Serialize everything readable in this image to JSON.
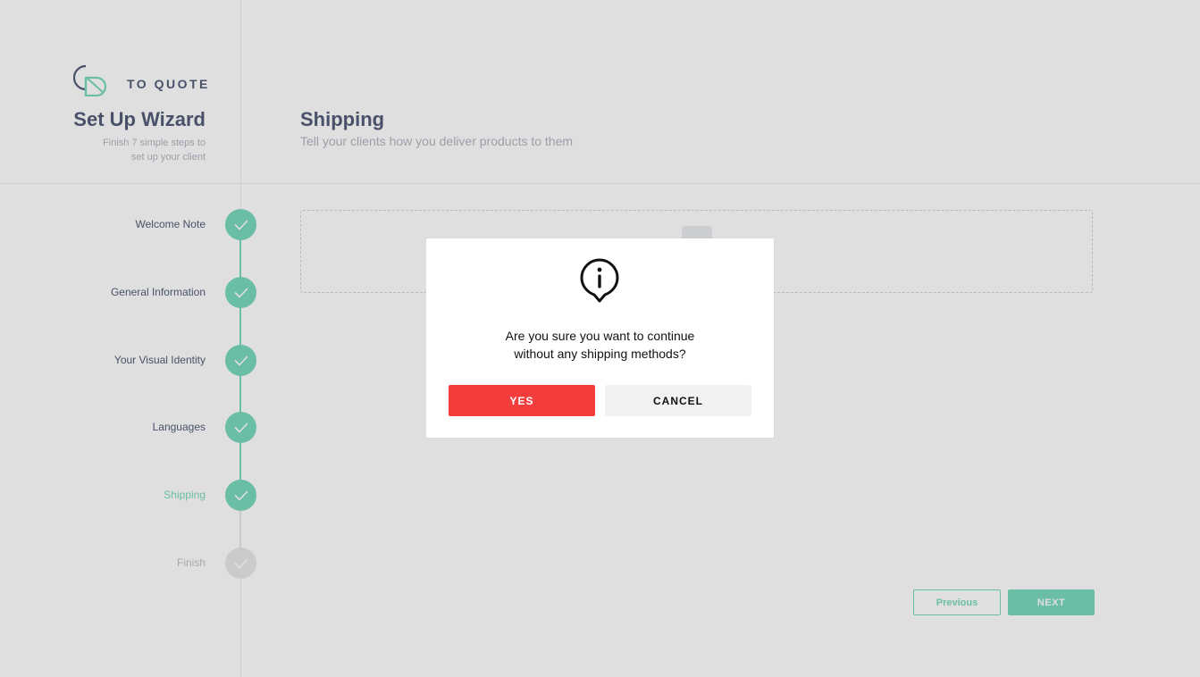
{
  "brand": {
    "name": "TO QUOTE"
  },
  "sidebar": {
    "title": "Set Up Wizard",
    "subtitle_line1": "Finish 7 simple steps to",
    "subtitle_line2": "set up your client",
    "steps": [
      {
        "label": "Welcome Note",
        "status": "done"
      },
      {
        "label": "General Information",
        "status": "done"
      },
      {
        "label": "Your Visual Identity",
        "status": "done"
      },
      {
        "label": "Languages",
        "status": "done"
      },
      {
        "label": "Shipping",
        "status": "active"
      },
      {
        "label": "Finish",
        "status": "pending"
      }
    ]
  },
  "page": {
    "title": "Shipping",
    "subtitle": "Tell your clients how you deliver products to them"
  },
  "footer": {
    "previous_label": "Previous",
    "next_label": "NEXT"
  },
  "modal": {
    "icon": "info-icon",
    "message_line1": "Are you sure you want to continue",
    "message_line2": "without any shipping methods?",
    "yes_label": "YES",
    "cancel_label": "CANCEL"
  },
  "colors": {
    "accent": "#5fd1b1",
    "danger": "#f33d3d",
    "text": "#2f3b5c",
    "muted": "#a2a7b5"
  }
}
